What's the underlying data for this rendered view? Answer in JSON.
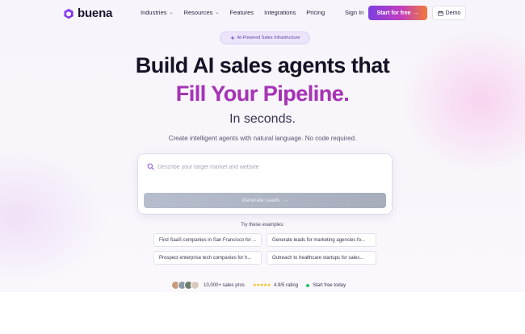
{
  "nav": {
    "brand": "buena",
    "links": [
      {
        "label": "Industries",
        "has_dropdown": true
      },
      {
        "label": "Resources",
        "has_dropdown": true
      },
      {
        "label": "Features",
        "has_dropdown": false
      },
      {
        "label": "Integrations",
        "has_dropdown": false
      },
      {
        "label": "Pricing",
        "has_dropdown": false
      }
    ],
    "sign_in": "Sign In",
    "start_free": "Start for free",
    "demo": "Demo"
  },
  "hero": {
    "badge": "AI-Powered Sales Infrastructure",
    "title_line1": "Build AI sales agents that",
    "title_line2": "Fill Your Pipeline.",
    "subtitle": "In seconds.",
    "description": "Create intelligent agents with natural language. No code required."
  },
  "prompt": {
    "placeholder": "Describe your target market and website",
    "value": "",
    "button_label": "Generate Leads"
  },
  "examples": {
    "heading": "Try these examples:",
    "items": [
      "Find SaaS companies in San Francisco for ...",
      "Generate leads for marketing agencies fo...",
      "Prospect enterprise tech companies for h...",
      "Outreach to healthcare startups for sales..."
    ]
  },
  "social_proof": {
    "users": "10,000+ sales pros",
    "stars": "★★★★★",
    "rating": "4.9/5 rating",
    "cta": "Start free today"
  },
  "colors": {
    "brand_purple": "#7b3fe0",
    "heading_gradient": [
      "#8a2fc0",
      "#c53aa8"
    ],
    "cta_gradient": [
      "#7b3fe0",
      "#c13dbf",
      "#f07a3a"
    ],
    "status_green": "#22c55e",
    "star_gold": "#f4b400"
  },
  "icons": {
    "logo": "hexagon-logo-icon",
    "badge": "sparkle-icon",
    "search": "search-icon",
    "arrow": "arrow-right-icon",
    "calendar": "calendar-icon"
  }
}
